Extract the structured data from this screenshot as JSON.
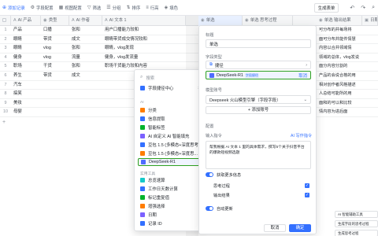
{
  "toolbar": {
    "add_record": "添加记录",
    "field_config": "字段配置",
    "view_config": "视图配置",
    "filter": "筛选",
    "group": "分组",
    "sort": "排序",
    "row_height": "行高",
    "fill_color": "填色",
    "generate_form": "生成表单"
  },
  "columns": [
    "AI 产品",
    "类型",
    "AI 作者",
    "AI 文本 1",
    "单选",
    "单选 思考过程",
    "单选 输出结果",
    "日期"
  ],
  "rows": [
    {
      "idx": "1",
      "product": "产品",
      "type": "口播",
      "author": "张和",
      "text": "用户口播能力较和",
      "right": "可分布的并每场将"
    },
    {
      "idx": "2",
      "product": "眼睛",
      "type": "带货",
      "author": "成文",
      "text": "眼睛带货成交情况较和",
      "right": "面可分布并能件情慧"
    },
    {
      "idx": "3",
      "product": "眼睛",
      "type": "vlog",
      "author": "张和",
      "text": "眼睛，vlog发现",
      "right": "内容以合并领域情"
    },
    {
      "idx": "4",
      "product": "健身",
      "type": "vlog",
      "author": "流量",
      "text": "健身，vlog发流量",
      "right": "领域的总体，vlog发说"
    },
    {
      "idx": "5",
      "product": "职场",
      "type": "干货",
      "author": "张和",
      "text": "职场干货能力较和内容",
      "right": "面分内容分割的"
    },
    {
      "idx": "6",
      "product": "养生",
      "type": "带货",
      "author": "成文",
      "text": "",
      "right": "产品的会说合格的用"
    },
    {
      "idx": "7",
      "product": "汽车",
      "type": "",
      "author": "",
      "text": "",
      "right": "相对创作者风格描述"
    },
    {
      "idx": "8",
      "product": "搞笑",
      "type": "",
      "author": "",
      "text": "",
      "right": "人总结可能所的用"
    },
    {
      "idx": "9",
      "product": "美妆",
      "type": "",
      "author": "",
      "text": "",
      "right": "面和的可以和比较"
    },
    {
      "idx": "10",
      "product": "母婴",
      "type": "",
      "author": "",
      "text": "",
      "right": "情内容为进后面"
    }
  ],
  "add_row": "+",
  "dropdown": {
    "search_placeholder": "搜索",
    "field_shortcut": "字段捷径中心",
    "section_ai": "AI",
    "ai_items": [
      {
        "label": "分类",
        "color": "#ff7d00"
      },
      {
        "label": "信息提取",
        "color": "#3370ff"
      },
      {
        "label": "智能标签",
        "color": "#00b42a"
      },
      {
        "label": "AI 自定义 AI 智能填充",
        "color": "#7b61ff"
      },
      {
        "label": "豆包 1.5 (多模态+深度思考)",
        "color": "#3370ff"
      },
      {
        "label": "豆包 1.5 (多模态+深度思...",
        "color": "#ff7d00"
      },
      {
        "label": "DeepSeek-R1",
        "color": "#4e6bff"
      }
    ],
    "section_tools": "实用工具",
    "tool_items": [
      {
        "label": "总览速算",
        "color": "#14c9c9"
      },
      {
        "label": "工作日天数计算",
        "color": "#3370ff"
      },
      {
        "label": "标记重复值",
        "color": "#00b42a"
      },
      {
        "label": "增强选择",
        "color": "#ff7d00"
      },
      {
        "label": "日期",
        "color": "#7b61ff"
      },
      {
        "label": "记录 ID",
        "color": "#3370ff"
      }
    ]
  },
  "modal": {
    "title_label": "标题",
    "title_value": "单选",
    "field_type_label": "字段类型",
    "shortcut_label": "捷径",
    "shortcut_value": "DeepSeek-R1",
    "shortcut_badge": "字段捷径",
    "shortcut_action": "取消",
    "model_label": "模型账号",
    "model_value": "Deepseek 火山模型引擎（字段字段）",
    "add_account": "+ 添加账号",
    "config_label": "配置",
    "prompt_label": "输入指令",
    "prompt_ai": "AI 写作指令",
    "prompt_text": "帮我根据 AI 文本 1 里的具体需求，撰写5个关于抖音平台的爆款短视频选题",
    "output_label": "获取更多信息",
    "think_label": "思考过程",
    "result_label": "输出结果",
    "auto_update": "自动更新",
    "cancel": "取消",
    "ok": "确定"
  },
  "bottom_buttons": [
    "AI 智能辅助工具",
    "生成字段的思考过程",
    "生成思考过程"
  ]
}
